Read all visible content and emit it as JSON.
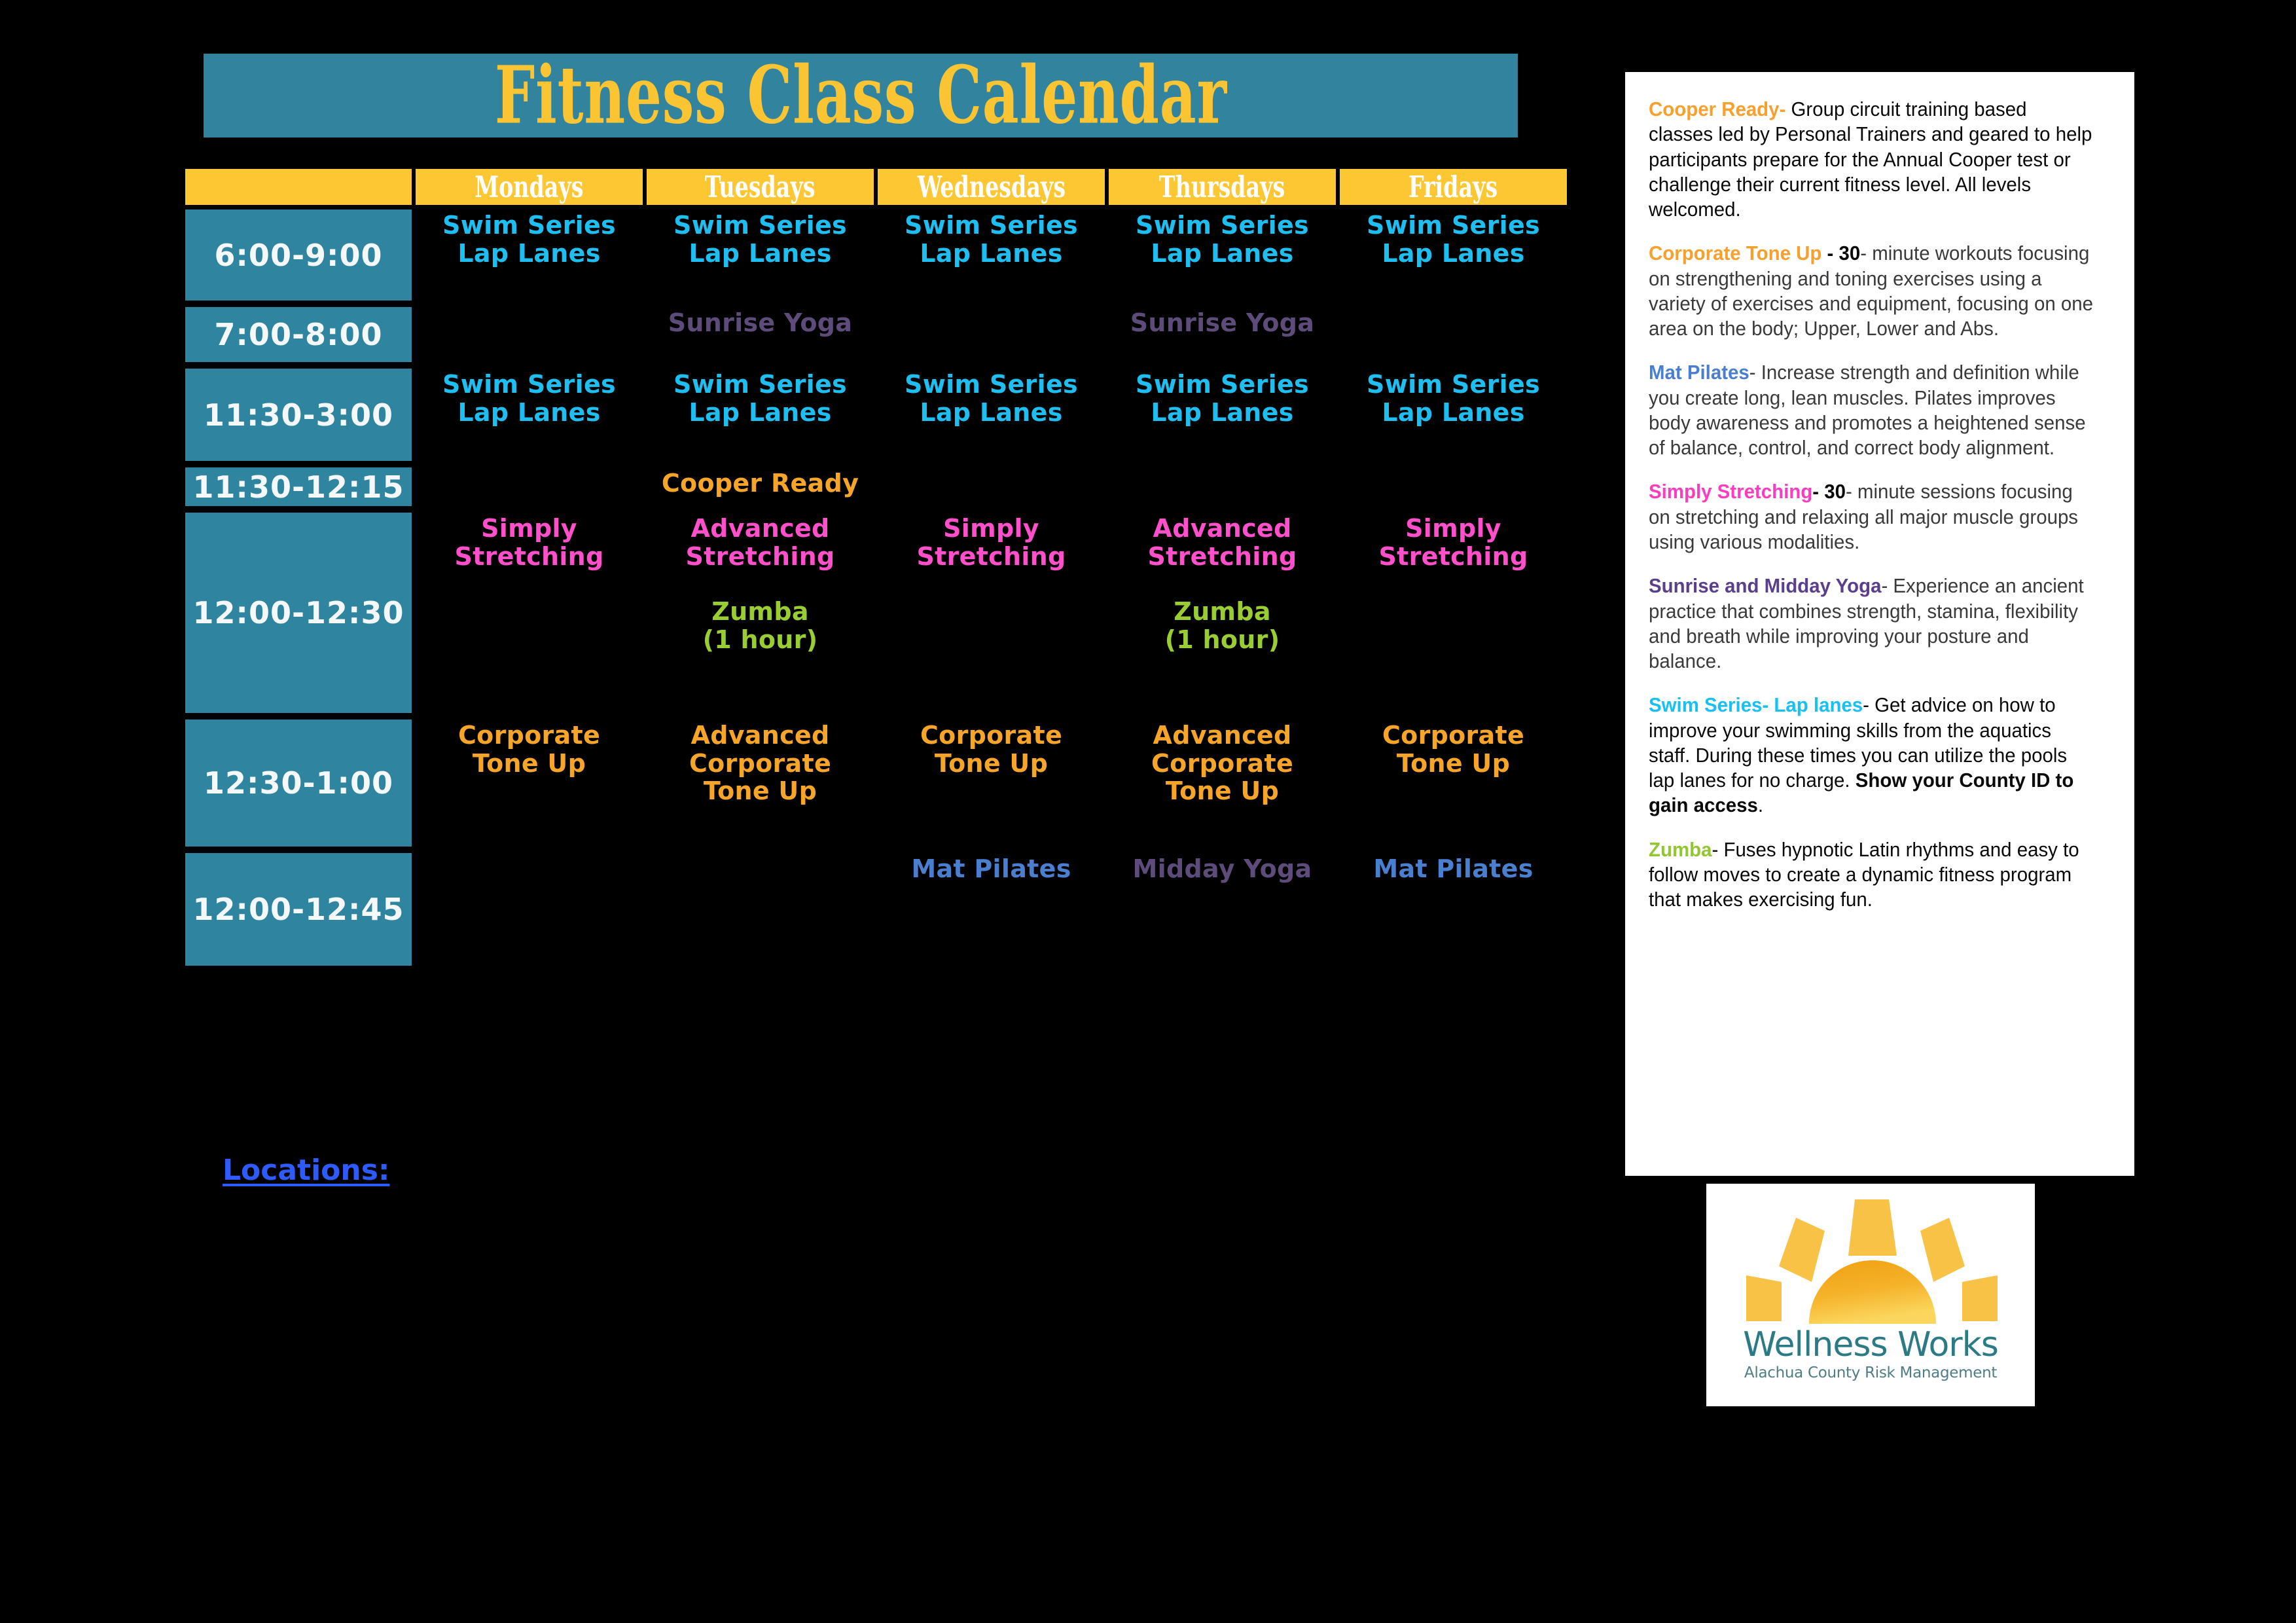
{
  "header": {
    "title": "Fitness Class Calendar",
    "title_bg": "#32849E",
    "title_color": "#FBC432"
  },
  "calendar": {
    "days": [
      "Mondays",
      "Tuesdays",
      "Wednesdays",
      "Thursdays",
      "Fridays"
    ],
    "rows": [
      {
        "time": "6:00-9:00",
        "cells": [
          {
            "text": "Swim Series\nLap Lanes",
            "style": "c-swim"
          },
          {
            "text": "Swim Series\nLap Lanes",
            "style": "c-swim"
          },
          {
            "text": "Swim Series\nLap Lanes",
            "style": "c-swim"
          },
          {
            "text": "Swim Series\nLap Lanes",
            "style": "c-swim"
          },
          {
            "text": "Swim Series\nLap Lanes",
            "style": "c-swim"
          }
        ]
      },
      {
        "time": "7:00-8:00",
        "cells": [
          {
            "text": "",
            "style": ""
          },
          {
            "text": "Sunrise Yoga",
            "style": "c-yoga"
          },
          {
            "text": "",
            "style": ""
          },
          {
            "text": "Sunrise Yoga",
            "style": "c-yoga"
          },
          {
            "text": "",
            "style": ""
          }
        ]
      },
      {
        "time": "11:30-3:00",
        "cells": [
          {
            "text": "Swim Series\nLap Lanes",
            "style": "c-swim"
          },
          {
            "text": "Swim Series\nLap Lanes",
            "style": "c-swim"
          },
          {
            "text": "Swim Series\nLap Lanes",
            "style": "c-swim"
          },
          {
            "text": "Swim Series\nLap Lanes",
            "style": "c-swim"
          },
          {
            "text": "Swim Series\nLap Lanes",
            "style": "c-swim"
          }
        ]
      },
      {
        "time": "11:30-12:15",
        "cells": [
          {
            "text": "",
            "style": ""
          },
          {
            "text": "Cooper Ready",
            "style": "c-cooper"
          },
          {
            "text": "",
            "style": ""
          },
          {
            "text": "",
            "style": ""
          },
          {
            "text": "",
            "style": ""
          }
        ]
      },
      {
        "time": "12:00-12:30",
        "cells": [
          {
            "text": "Simply\nStretching",
            "style": "c-stretch"
          },
          {
            "text": "Advanced\nStretching",
            "style": "c-stretch",
            "second": {
              "text": "Zumba\n(1 hour)",
              "style": "c-zumba"
            }
          },
          {
            "text": "Simply\nStretching",
            "style": "c-stretch"
          },
          {
            "text": "Advanced\nStretching",
            "style": "c-stretch",
            "second": {
              "text": "Zumba\n(1 hour)",
              "style": "c-zumba"
            }
          },
          {
            "text": "Simply\nStretching",
            "style": "c-stretch"
          }
        ]
      },
      {
        "time": "12:30-1:00",
        "cells": [
          {
            "text": "Corporate\nTone Up",
            "style": "c-tone"
          },
          {
            "text": "Advanced\nCorporate\nTone Up",
            "style": "c-tone"
          },
          {
            "text": "Corporate\nTone Up",
            "style": "c-tone"
          },
          {
            "text": "Advanced\nCorporate\nTone Up",
            "style": "c-tone"
          },
          {
            "text": "Corporate\nTone Up",
            "style": "c-tone"
          }
        ]
      },
      {
        "time": "12:00-12:45",
        "cells": [
          {
            "text": "",
            "style": ""
          },
          {
            "text": "",
            "style": ""
          },
          {
            "text": "Mat Pilates",
            "style": "c-pilates"
          },
          {
            "text": "Midday Yoga",
            "style": "c-yoga"
          },
          {
            "text": "Mat Pilates",
            "style": "c-pilates"
          }
        ]
      }
    ]
  },
  "locations": {
    "label": "Locations:"
  },
  "descriptions": [
    {
      "term": "Cooper Ready-",
      "term_style": "t-cooper",
      "body": " Group circuit training based classes led by Personal Trainers and geared to help participants prepare for the Annual Cooper test or challenge their current fitness level. All levels welcomed.",
      "body_dark": true
    },
    {
      "term": "Corporate Tone Up",
      "term_style": "t-tone",
      "pre_bold": " - 30",
      "body": "- minute workouts focusing on strengthening and toning exercises using a variety of exercises and equipment,  focusing on one area on the body; Upper, Lower and Abs.",
      "body_dark": false
    },
    {
      "term": "Mat Pilates",
      "term_style": "t-pilates",
      "body": "- Increase strength and definition while you create long, lean muscles. Pilates improves body awareness and promotes a heightened sense of balance, control, and correct body alignment.",
      "body_dark": false
    },
    {
      "term": "Simply Stretching",
      "term_style": "t-stretch",
      "pre_bold": "- 30",
      "body": "- minute sessions focusing on stretching and relaxing all major muscle groups using various modalities.",
      "body_dark": false
    },
    {
      "term": "Sunrise and Midday Yoga",
      "term_style": "t-yoga",
      "body": "- Experience an ancient practice that combines strength, stamina, flexibility and breath while improving your posture and balance.",
      "body_dark": false
    },
    {
      "term": "Swim Series- Lap lanes",
      "term_style": "t-swim",
      "body": "- Get advice on how to improve your swimming skills from the aquatics staff. During these times you can utilize the pools lap lanes for no charge. ",
      "trail_bold": "Show your County ID to gain access",
      "trail": ".",
      "body_dark": true
    },
    {
      "term": "Zumba",
      "term_style": "t-zumba",
      "body": "- Fuses hypnotic Latin rhythms and easy to follow moves to create a dynamic fitness program that makes exercising fun.",
      "body_dark": true
    }
  ],
  "logo": {
    "name": "Wellness Works",
    "subtitle": "Alachua County Risk Management",
    "sun_color": "#F8C246",
    "core_color": "#F2A416"
  }
}
